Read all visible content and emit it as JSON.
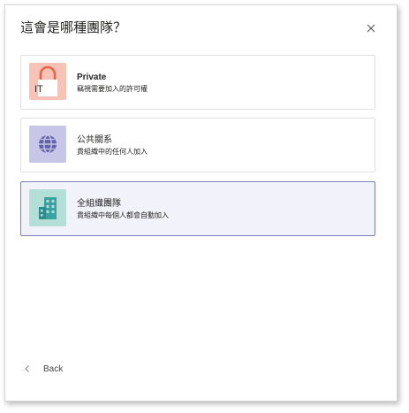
{
  "dialog": {
    "title": "這會是哪種團隊？",
    "close_icon": "close-icon",
    "back_label": "Back"
  },
  "options": [
    {
      "id": "private",
      "title": "Private",
      "description": "竊視需要加入的許可權",
      "tile_label": "IT",
      "icon": "lock-icon",
      "tile_color": "#f8c3b6",
      "selected": false
    },
    {
      "id": "public",
      "title": "公共關系",
      "description": "貴組織中的任何人加入",
      "icon": "globe-icon",
      "tile_color": "#c7c5e8",
      "selected": false
    },
    {
      "id": "org-wide",
      "title": "全組織團隊",
      "description": "貴組織中每個人都會自動加入",
      "icon": "building-icon",
      "tile_color": "#b3dfd7",
      "selected": true
    }
  ],
  "colors": {
    "accent": "#6264a7",
    "selected_bg": "#f2f2fa",
    "selected_border": "#7b7fc2",
    "private_icon": "#e4664d",
    "public_icon": "#6264a7",
    "org_icon": "#3aa0a0"
  }
}
